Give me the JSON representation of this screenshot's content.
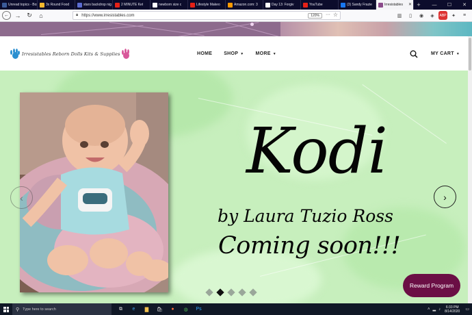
{
  "browser": {
    "tabs": [
      {
        "label": "Unread topics - Box",
        "color": "#3b5b9a",
        "active": false
      },
      {
        "label": "3x Round Food",
        "color": "#f5b82e",
        "active": false
      },
      {
        "label": "stars backdrop nig",
        "color": "#5b6bd1",
        "active": false
      },
      {
        "label": "2 MINUTE Ket",
        "color": "#e62117",
        "active": false
      },
      {
        "label": "newborn size c",
        "color": "#ffffff",
        "active": false
      },
      {
        "label": "Lifestyle Makeo",
        "color": "#e62117",
        "active": false
      },
      {
        "label": "Amazon.com: 3",
        "color": "#ff9900",
        "active": false
      },
      {
        "label": "Day 13: Forgiv",
        "color": "#ffffff",
        "active": false
      },
      {
        "label": "YouTube",
        "color": "#e62117",
        "active": false
      },
      {
        "label": "(3) Sandy Frazie",
        "color": "#1877f2",
        "active": false
      },
      {
        "label": "Irresistables",
        "color": "#8a4a8a",
        "active": true
      }
    ],
    "new_tab": "+",
    "window_controls": {
      "minimize": "—",
      "maximize": "☐",
      "close": "✕"
    },
    "url": "https://www.irresistables.com",
    "zoom": "120%"
  },
  "site": {
    "logo_text": "Irresistables  Reborn Dolls Kits & Supplies",
    "nav": [
      {
        "label": "HOME",
        "dropdown": false
      },
      {
        "label": "SHOP",
        "dropdown": true
      },
      {
        "label": "MORE",
        "dropdown": true
      }
    ],
    "cart_label": "MY CART"
  },
  "hero": {
    "title": "Kodi",
    "author": "by Laura Tuzio Ross",
    "coming": "Coming soon!!!",
    "slide_count": 5,
    "active_slide": 2
  },
  "reward_label": "Reward Program",
  "taskbar": {
    "search_placeholder": "Type here to search",
    "time": "6:33 PM",
    "date": "8/14/2020"
  },
  "colors": {
    "hero_bg": "#c7efbd",
    "reward_bg": "#6b0f45",
    "banner": "#8d6b8d"
  }
}
